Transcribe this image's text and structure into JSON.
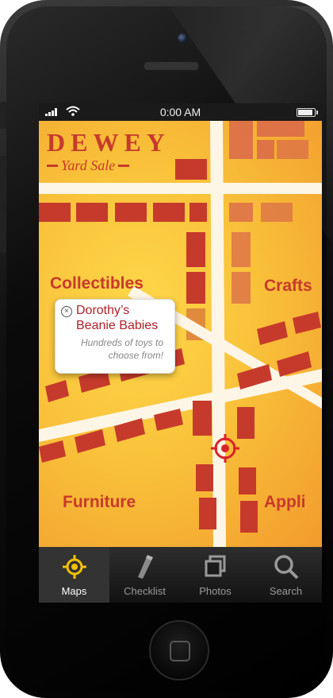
{
  "status_bar": {
    "time": "0:00 AM"
  },
  "logo": {
    "title": "DEWEY",
    "subtitle": "Yard Sale"
  },
  "districts": {
    "collectibles": "Collectibles",
    "crafts": "Crafts",
    "furniture": "Furniture",
    "appliances": "Appli"
  },
  "callout": {
    "title": "Dorothy’s Beanie Babies",
    "description": "Hundreds of toys to choose from!",
    "close_icon": "close-icon"
  },
  "tabs": [
    {
      "label": "Maps",
      "icon": "target-icon",
      "active": true
    },
    {
      "label": "Checklist",
      "icon": "pencil-icon",
      "active": false
    },
    {
      "label": "Photos",
      "icon": "photos-icon",
      "active": false
    },
    {
      "label": "Search",
      "icon": "search-icon",
      "active": false
    }
  ],
  "colors": {
    "map_orange": "#f9c23a",
    "block_red": "#c63a2c",
    "road_white": "#fdf6e6",
    "accent_yellow": "#f2c200"
  }
}
